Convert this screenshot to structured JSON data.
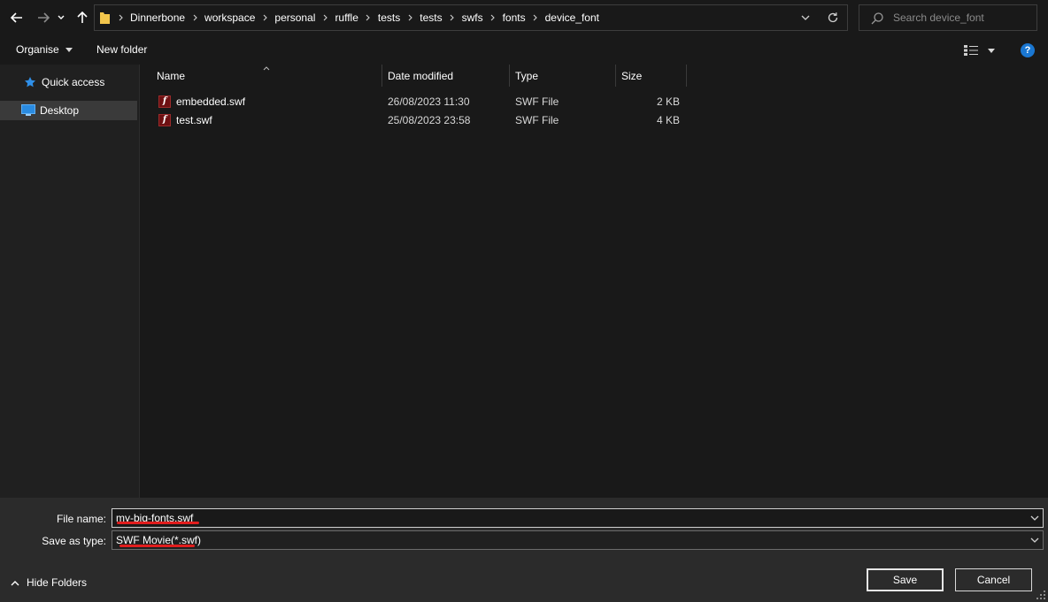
{
  "nav": {
    "breadcrumbs": [
      "Dinnerbone",
      "workspace",
      "personal",
      "ruffle",
      "tests",
      "tests",
      "swfs",
      "fonts",
      "device_font"
    ],
    "search_placeholder": "Search device_font"
  },
  "toolbar": {
    "organise_label": "Organise",
    "new_folder_label": "New folder",
    "help_label": "?"
  },
  "sidebar": {
    "items": [
      {
        "label": "Quick access",
        "icon": "star-icon"
      },
      {
        "label": "Desktop",
        "icon": "desktop-icon",
        "selected": true
      }
    ]
  },
  "columns": {
    "name": "Name",
    "date_modified": "Date modified",
    "type": "Type",
    "size": "Size"
  },
  "files": [
    {
      "name": "embedded.swf",
      "date": "26/08/2023 11:30",
      "type": "SWF File",
      "size": "2 KB",
      "icon": "flash-file-icon"
    },
    {
      "name": "test.swf",
      "date": "25/08/2023 23:58",
      "type": "SWF File",
      "size": "4 KB",
      "icon": "flash-file-icon"
    }
  ],
  "form": {
    "file_name_label": "File name:",
    "file_name_value": "my-big-fonts.swf",
    "save_type_label": "Save as type:",
    "save_type_value": "SWF Movie(*.swf)"
  },
  "footer": {
    "hide_folders_label": "Hide Folders",
    "save_label": "Save",
    "cancel_label": "Cancel"
  },
  "colors": {
    "background": "#191919",
    "sidebar": "#202020",
    "bottom_panel": "#2b2b2b",
    "accent": "#1a77d2",
    "spellcheck": "#e11d1d",
    "swf_icon": "#6d1012"
  }
}
